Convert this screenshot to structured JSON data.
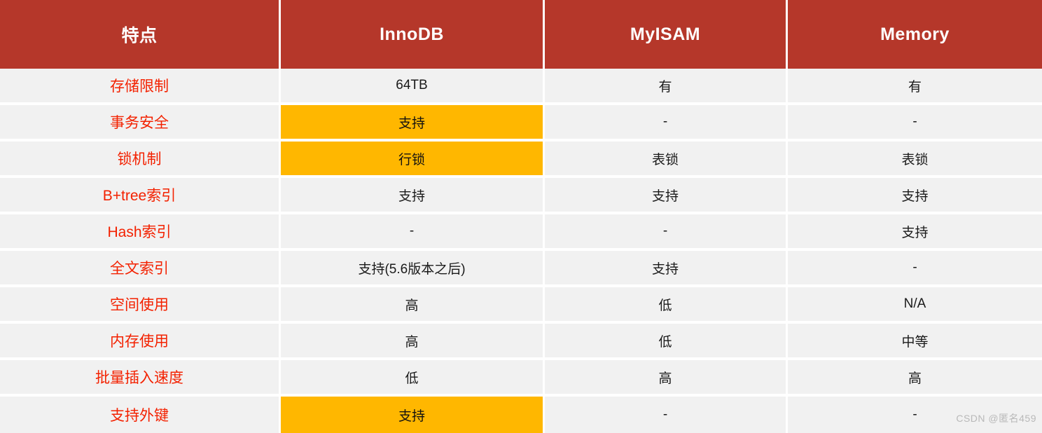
{
  "table": {
    "columns": [
      "特点",
      "InnoDB",
      "MyISAM",
      "Memory"
    ],
    "rows": [
      {
        "feature": "存储限制",
        "innodb": "64TB",
        "myisam": "有",
        "memory": "有",
        "highlight_innodb": false
      },
      {
        "feature": "事务安全",
        "innodb": "支持",
        "myisam": "-",
        "memory": "-",
        "highlight_innodb": true
      },
      {
        "feature": "锁机制",
        "innodb": "行锁",
        "myisam": "表锁",
        "memory": "表锁",
        "highlight_innodb": true
      },
      {
        "feature": "B+tree索引",
        "innodb": "支持",
        "myisam": "支持",
        "memory": "支持",
        "highlight_innodb": false
      },
      {
        "feature": "Hash索引",
        "innodb": "-",
        "myisam": "-",
        "memory": "支持",
        "highlight_innodb": false
      },
      {
        "feature": "全文索引",
        "innodb": "支持(5.6版本之后)",
        "myisam": "支持",
        "memory": "-",
        "highlight_innodb": false
      },
      {
        "feature": "空间使用",
        "innodb": "高",
        "myisam": "低",
        "memory": "N/A",
        "highlight_innodb": false
      },
      {
        "feature": "内存使用",
        "innodb": "高",
        "myisam": "低",
        "memory": "中等",
        "highlight_innodb": false
      },
      {
        "feature": "批量插入速度",
        "innodb": "低",
        "myisam": "高",
        "memory": "高",
        "highlight_innodb": false
      },
      {
        "feature": "支持外键",
        "innodb": "支持",
        "myisam": "-",
        "memory": "-",
        "highlight_innodb": true
      }
    ]
  },
  "watermark": {
    "text": "CSDN @匿名459"
  },
  "colors": {
    "header_bg": "#b5372a",
    "header_text": "#ffffff",
    "cell_bg": "#f1f1f1",
    "feature_text": "#f32100",
    "highlight_bg": "#ffb700",
    "page_bg": "#ffffff"
  }
}
